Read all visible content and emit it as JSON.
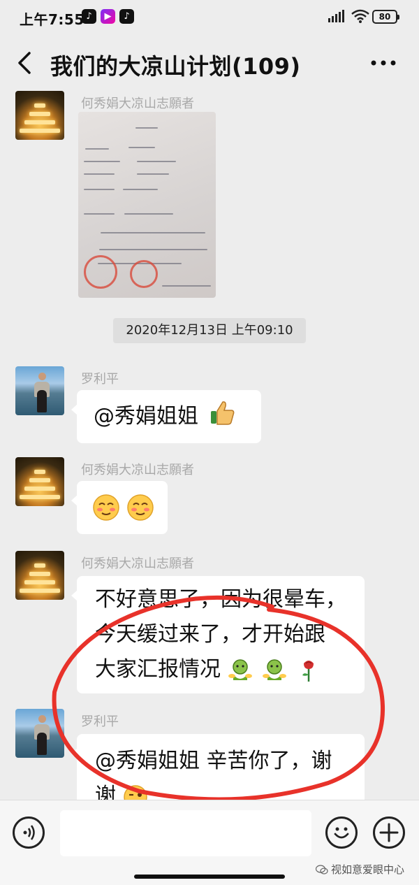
{
  "status_bar": {
    "time": "上午7:55",
    "apps": [
      "tiktok-icon",
      "video-app-icon",
      "tiktok-icon"
    ],
    "battery": "80"
  },
  "header": {
    "title": "我们的大凉山计划(109)",
    "back_icon": "chevron-left-icon",
    "more_icon": "more-dots-icon"
  },
  "chat": {
    "messages": [
      {
        "sender": "何秀娟大凉山志願者",
        "type": "image",
        "image_desc": "handwritten-document-photo"
      },
      {
        "type": "timestamp",
        "text": "2020年12月13日 上午09:10"
      },
      {
        "sender": "罗利平",
        "type": "text",
        "text": "@秀娟姐姐",
        "emoji": [
          "thumbs-up-icon"
        ]
      },
      {
        "sender": "何秀娟大凉山志願者",
        "type": "emoji",
        "emoji": [
          "blush-face-icon",
          "blush-face-icon"
        ]
      },
      {
        "sender": "何秀娟大凉山志願者",
        "type": "text",
        "lines": [
          "不好意思了，因为很晕车，",
          "今天缓过来了，才开始跟",
          "大家汇报情况"
        ],
        "emoji": [
          "hug-icon",
          "hug-icon",
          "rose-icon"
        ],
        "highlighted": true
      },
      {
        "sender": "罗利平",
        "type": "text",
        "lines": [
          "@秀娟姐姐  辛苦你了，谢",
          "谢"
        ],
        "emoji": [
          "wink-face-icon"
        ]
      }
    ]
  },
  "input_bar": {
    "voice_icon": "voice-icon",
    "emoji_icon": "smiley-icon",
    "add_icon": "plus-icon",
    "watermark": "视如意爱眼中心"
  },
  "colors": {
    "background": "#ededed",
    "bubble": "#ffffff",
    "highlight_circle": "#e8322a",
    "sender_name": "#a8a8a8"
  }
}
